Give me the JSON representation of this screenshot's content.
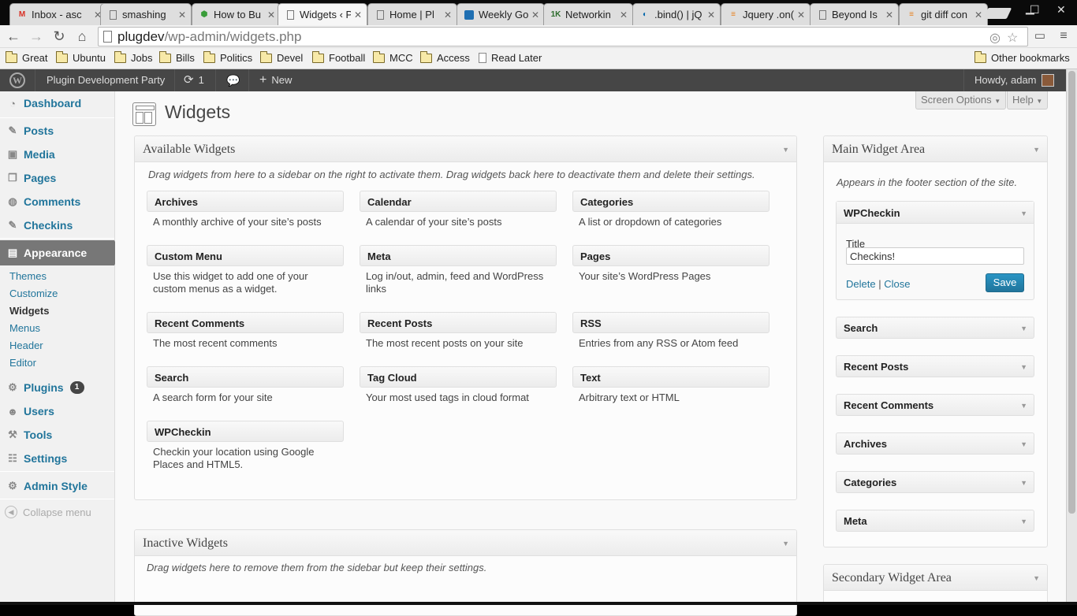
{
  "browser": {
    "tabs": [
      {
        "title": "Inbox - asc",
        "favicon": "gmail-icon"
      },
      {
        "title": "smashing",
        "favicon": "page-icon"
      },
      {
        "title": "How to Bu",
        "favicon": "green-gear-icon"
      },
      {
        "title": "Widgets ‹ P",
        "favicon": "page-icon"
      },
      {
        "title": "Home | Pl",
        "favicon": "page-icon"
      },
      {
        "title": "Weekly Go",
        "favicon": "trello-icon"
      },
      {
        "title": "Networkin",
        "favicon": "1k-icon"
      },
      {
        "title": ".bind() | jQ",
        "favicon": "jquery-icon"
      },
      {
        "title": "Jquery .on(",
        "favicon": "stackoverflow-icon"
      },
      {
        "title": "Beyond Is",
        "favicon": "page-icon"
      },
      {
        "title": "git diff con",
        "favicon": "stackoverflow-icon"
      }
    ],
    "url_host": "plugdev",
    "url_path": "/wp-admin/widgets.php",
    "bookmarks": [
      "Great",
      "Ubuntu",
      "Jobs",
      "Bills",
      "Politics",
      "Devel",
      "Football",
      "MCC",
      "Access"
    ],
    "read_later": "Read Later",
    "other_bookmarks": "Other bookmarks"
  },
  "adminbar": {
    "site_name": "Plugin Development Party",
    "updates_count": "1",
    "new_label": "New",
    "howdy": "Howdy, adam"
  },
  "menu": {
    "dashboard": "Dashboard",
    "posts": "Posts",
    "media": "Media",
    "pages": "Pages",
    "comments": "Comments",
    "checkins": "Checkins",
    "appearance": "Appearance",
    "sub": {
      "themes": "Themes",
      "customize": "Customize",
      "widgets": "Widgets",
      "menus": "Menus",
      "header": "Header",
      "editor": "Editor"
    },
    "plugins": "Plugins",
    "plugins_badge": "1",
    "users": "Users",
    "tools": "Tools",
    "settings": "Settings",
    "admin_style": "Admin Style",
    "collapse": "Collapse menu"
  },
  "header": {
    "screen_options": "Screen Options",
    "help": "Help",
    "title": "Widgets"
  },
  "available": {
    "title": "Available Widgets",
    "description": "Drag widgets from here to a sidebar on the right to activate them. Drag widgets back here to deactivate them and delete their settings.",
    "widgets": [
      {
        "name": "Archives",
        "desc": "A monthly archive of your site’s posts"
      },
      {
        "name": "Calendar",
        "desc": "A calendar of your site’s posts"
      },
      {
        "name": "Categories",
        "desc": "A list or dropdown of categories"
      },
      {
        "name": "Custom Menu",
        "desc": "Use this widget to add one of your custom menus as a widget."
      },
      {
        "name": "Meta",
        "desc": "Log in/out, admin, feed and WordPress links"
      },
      {
        "name": "Pages",
        "desc": "Your site’s WordPress Pages"
      },
      {
        "name": "Recent Comments",
        "desc": "The most recent comments"
      },
      {
        "name": "Recent Posts",
        "desc": "The most recent posts on your site"
      },
      {
        "name": "RSS",
        "desc": "Entries from any RSS or Atom feed"
      },
      {
        "name": "Search",
        "desc": "A search form for your site"
      },
      {
        "name": "Tag Cloud",
        "desc": "Your most used tags in cloud format"
      },
      {
        "name": "Text",
        "desc": "Arbitrary text or HTML"
      },
      {
        "name": "WPCheckin",
        "desc": "Checkin your location using Google Places and HTML5."
      }
    ]
  },
  "inactive": {
    "title": "Inactive Widgets",
    "description": "Drag widgets here to remove them from the sidebar but keep their settings."
  },
  "main_area": {
    "title": "Main Widget Area",
    "description": "Appears in the footer section of the site.",
    "open_widget": {
      "name": "WPCheckin",
      "field_label": "Title",
      "field_value": "Checkins!",
      "delete": "Delete",
      "separator": "|",
      "close": "Close",
      "save": "Save"
    },
    "widgets": [
      "Search",
      "Recent Posts",
      "Recent Comments",
      "Archives",
      "Categories",
      "Meta"
    ]
  },
  "secondary_area": {
    "title": "Secondary Widget Area"
  },
  "colors": {
    "link": "#21759b",
    "adminbar": "#464646",
    "save_button": "#21759b"
  }
}
